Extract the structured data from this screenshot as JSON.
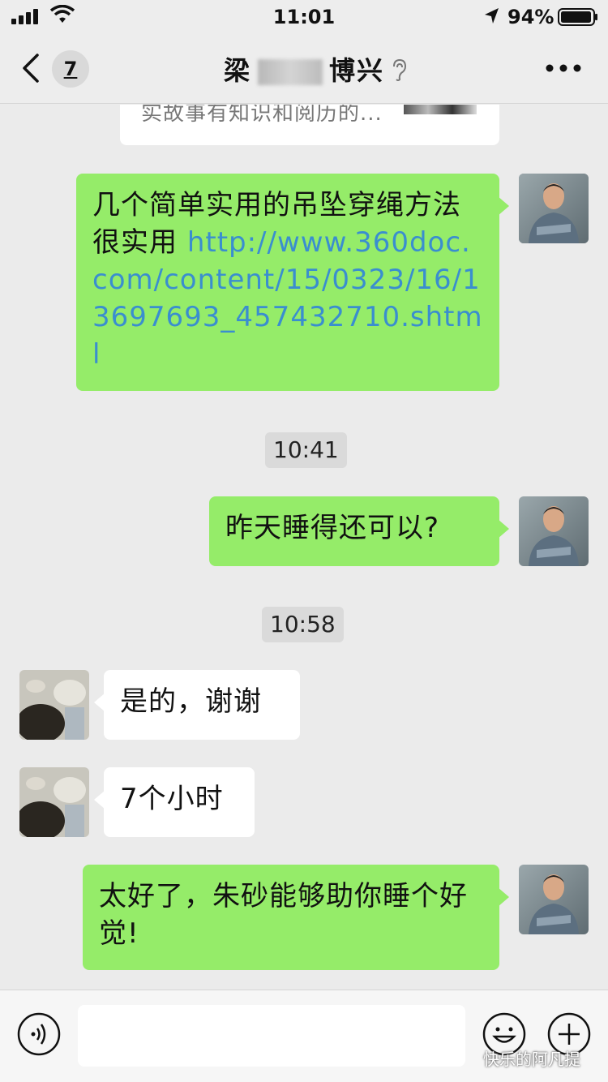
{
  "status_bar": {
    "time": "11:01",
    "battery": "94%"
  },
  "nav": {
    "unread_count": "7",
    "title_left": "梁",
    "title_right": "博兴"
  },
  "chat": {
    "link_preview": "实故事有知识和阅历的...",
    "messages": [
      {
        "side": "me",
        "text": "几个简单实用的吊坠穿绳方法很实用",
        "link": "http://www.360doc.com/content/15/0323/16/13697693_457432710.shtml"
      },
      {
        "type": "time",
        "text": "10:41"
      },
      {
        "side": "me",
        "text": "昨天睡得还可以?"
      },
      {
        "type": "time",
        "text": "10:58"
      },
      {
        "side": "other",
        "text": "是的，谢谢"
      },
      {
        "side": "other",
        "text": "7个小时"
      },
      {
        "side": "me",
        "text": "太好了，朱砂能够助你睡个好觉!"
      }
    ]
  },
  "input_bar": {
    "placeholder": ""
  },
  "watermark": "快乐的阿凡提",
  "colors": {
    "bubble_me": "#95ec69",
    "bubble_other": "#ffffff",
    "link": "#3a8ecf",
    "background": "#ebebeb"
  }
}
